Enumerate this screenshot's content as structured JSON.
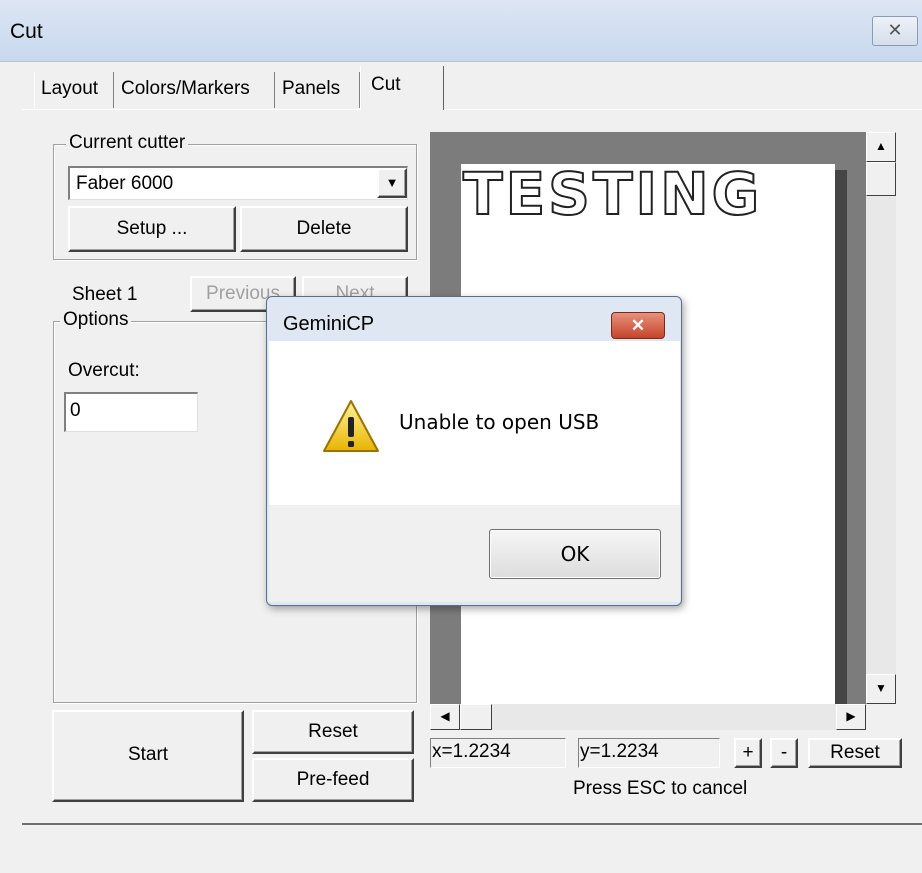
{
  "window": {
    "title": "Cut",
    "close_icon": "close-icon"
  },
  "tabs": [
    {
      "label": "Layout",
      "active": false
    },
    {
      "label": "Colors/Markers",
      "active": false
    },
    {
      "label": "Panels",
      "active": false
    },
    {
      "label": "Cut",
      "active": true
    }
  ],
  "cutter": {
    "group_label": "Current cutter",
    "selected": "Faber 6000",
    "setup_label": "Setup ...",
    "delete_label": "Delete"
  },
  "sheet": {
    "label": "Sheet 1",
    "previous_label": "Previous",
    "next_label": "Next"
  },
  "options": {
    "group_label": "Options",
    "overcut_label": "Overcut:",
    "overcut_value": "0"
  },
  "actions": {
    "start_label": "Start",
    "reset_label": "Reset",
    "prefeed_label": "Pre-feed"
  },
  "preview": {
    "text": "TESTING",
    "x_readout": "x=1.2234",
    "y_readout": "y=1.2234",
    "zoom_in_label": "+",
    "zoom_out_label": "-",
    "reset_label": "Reset",
    "hint": "Press ESC to cancel"
  },
  "modal": {
    "title": "GeminiCP",
    "message": "Unable to open USB",
    "ok_label": "OK",
    "icon": "warning-icon"
  }
}
